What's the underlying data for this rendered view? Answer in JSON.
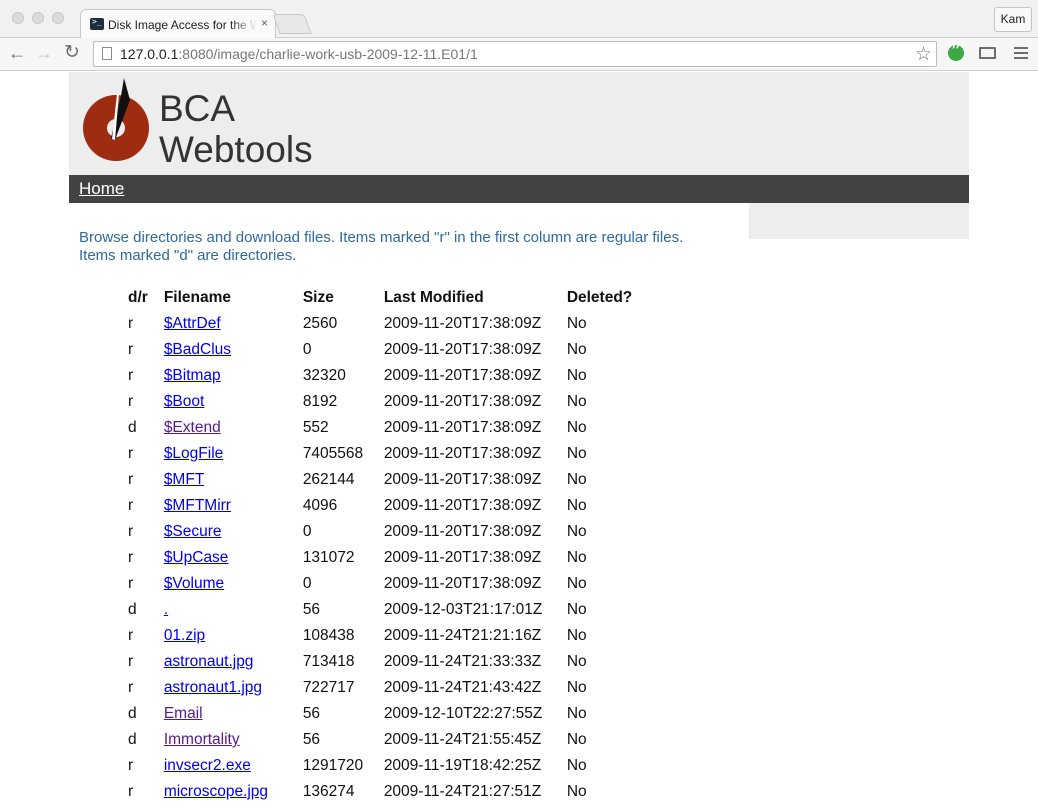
{
  "browser": {
    "tab_title": "Disk Image Access for the Web",
    "tab_close": "×",
    "user": "Kam",
    "url_host": "127.0.0.1",
    "url_rest": ":8080/image/charlie-work-usb-2009-12-11.E01/1"
  },
  "header": {
    "brand_line1": "BCA",
    "brand_line2": "Webtools"
  },
  "nav": {
    "home": "Home"
  },
  "intro": "Browse directories and download files. Items marked \"r\" in the first column are regular files. Items marked \"d\" are directories.",
  "table": {
    "headers": [
      "d/r",
      "Filename",
      "Size",
      "Last Modified",
      "Deleted?"
    ],
    "rows": [
      {
        "type": "r",
        "name": "$AttrDef",
        "size": "2560",
        "modified": "2009-11-20T17:38:09Z",
        "deleted": "No",
        "visited": false
      },
      {
        "type": "r",
        "name": "$BadClus",
        "size": "0",
        "modified": "2009-11-20T17:38:09Z",
        "deleted": "No",
        "visited": false
      },
      {
        "type": "r",
        "name": "$Bitmap",
        "size": "32320",
        "modified": "2009-11-20T17:38:09Z",
        "deleted": "No",
        "visited": false
      },
      {
        "type": "r",
        "name": "$Boot",
        "size": "8192",
        "modified": "2009-11-20T17:38:09Z",
        "deleted": "No",
        "visited": false
      },
      {
        "type": "d",
        "name": "$Extend",
        "size": "552",
        "modified": "2009-11-20T17:38:09Z",
        "deleted": "No",
        "visited": true
      },
      {
        "type": "r",
        "name": "$LogFile",
        "size": "7405568",
        "modified": "2009-11-20T17:38:09Z",
        "deleted": "No",
        "visited": false
      },
      {
        "type": "r",
        "name": "$MFT",
        "size": "262144",
        "modified": "2009-11-20T17:38:09Z",
        "deleted": "No",
        "visited": false
      },
      {
        "type": "r",
        "name": "$MFTMirr",
        "size": "4096",
        "modified": "2009-11-20T17:38:09Z",
        "deleted": "No",
        "visited": false
      },
      {
        "type": "r",
        "name": "$Secure",
        "size": "0",
        "modified": "2009-11-20T17:38:09Z",
        "deleted": "No",
        "visited": false
      },
      {
        "type": "r",
        "name": "$UpCase",
        "size": "131072",
        "modified": "2009-11-20T17:38:09Z",
        "deleted": "No",
        "visited": false
      },
      {
        "type": "r",
        "name": "$Volume",
        "size": "0",
        "modified": "2009-11-20T17:38:09Z",
        "deleted": "No",
        "visited": false
      },
      {
        "type": "d",
        "name": ".",
        "size": "56",
        "modified": "2009-12-03T21:17:01Z",
        "deleted": "No",
        "visited": false
      },
      {
        "type": "r",
        "name": "01.zip",
        "size": "108438",
        "modified": "2009-11-24T21:21:16Z",
        "deleted": "No",
        "visited": false
      },
      {
        "type": "r",
        "name": "astronaut.jpg",
        "size": "713418",
        "modified": "2009-11-24T21:33:33Z",
        "deleted": "No",
        "visited": false
      },
      {
        "type": "r",
        "name": "astronaut1.jpg",
        "size": "722717",
        "modified": "2009-11-24T21:43:42Z",
        "deleted": "No",
        "visited": false
      },
      {
        "type": "d",
        "name": "Email",
        "size": "56",
        "modified": "2009-12-10T22:27:55Z",
        "deleted": "No",
        "visited": true
      },
      {
        "type": "d",
        "name": "Immortality",
        "size": "56",
        "modified": "2009-11-24T21:55:45Z",
        "deleted": "No",
        "visited": true
      },
      {
        "type": "r",
        "name": "invsecr2.exe",
        "size": "1291720",
        "modified": "2009-11-19T18:42:25Z",
        "deleted": "No",
        "visited": false
      },
      {
        "type": "r",
        "name": "microscope.jpg",
        "size": "136274",
        "modified": "2009-11-24T21:27:51Z",
        "deleted": "No",
        "visited": false
      }
    ]
  },
  "colors": {
    "link": "#0000ee",
    "visited_link": "#551a8b",
    "intro_text": "#2f6a9b",
    "nav_bar": "#424242",
    "header_bg": "#ededed",
    "logo": "#9e2c10"
  },
  "icons": [
    "terminal-favicon-icon",
    "back-arrow-icon",
    "forward-arrow-icon",
    "reload-icon",
    "page-icon",
    "bookmark-star-icon",
    "hangouts-extension-icon",
    "cast-icon",
    "menu-icon",
    "bca-logo-icon"
  ]
}
